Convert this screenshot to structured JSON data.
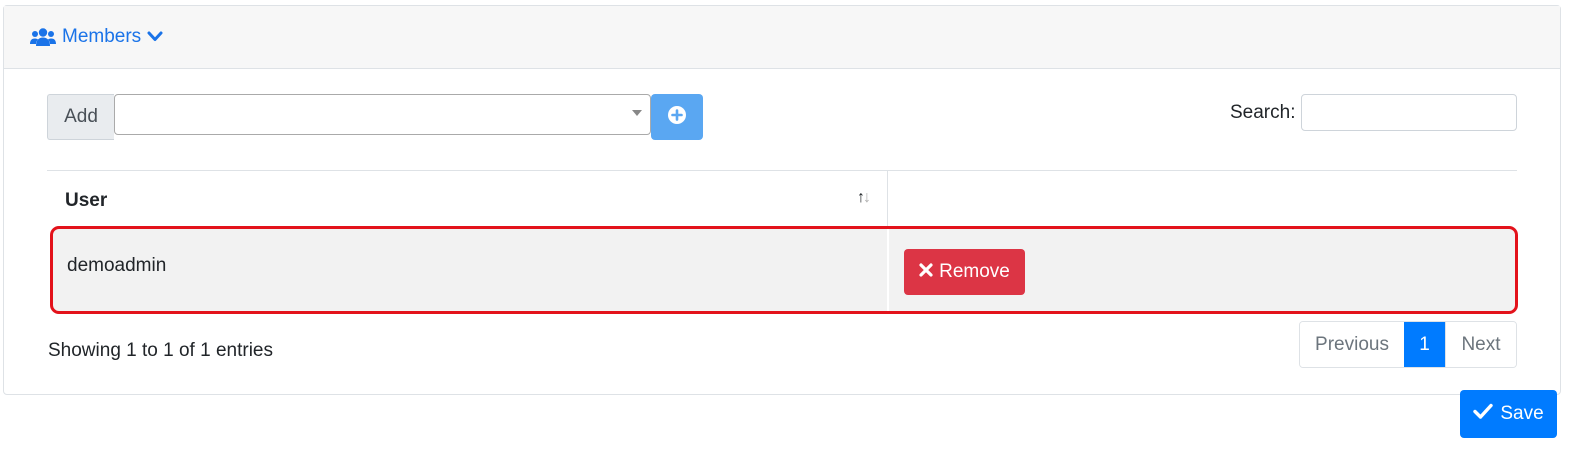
{
  "header": {
    "title": "Members",
    "icon": "users-icon",
    "chevron": "chevron-down-icon",
    "accent": "#1a73e8"
  },
  "add": {
    "label": "Add",
    "select_value": "",
    "button_icon": "plus-circle-icon"
  },
  "search": {
    "label": "Search:",
    "value": ""
  },
  "table": {
    "columns": [
      "User",
      ""
    ],
    "rows": [
      {
        "user": "demoadmin",
        "action_label": "Remove"
      }
    ]
  },
  "info": "Showing 1 to 1 of 1 entries",
  "pagination": {
    "previous": "Previous",
    "current": "1",
    "next": "Next"
  },
  "footer": {
    "save_label": "Save"
  },
  "colors": {
    "primary": "#007bff",
    "danger": "#dc3545",
    "highlight": "#e3121b"
  }
}
